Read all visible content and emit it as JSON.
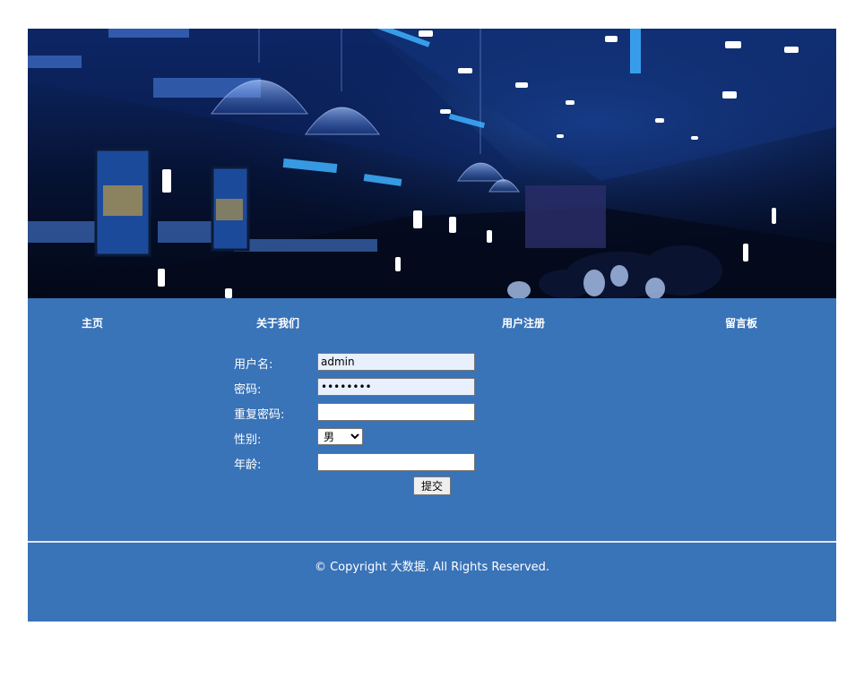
{
  "nav": {
    "items": [
      {
        "label": "主页"
      },
      {
        "label": "关于我们"
      },
      {
        "label": "用户注册"
      },
      {
        "label": "留言板"
      }
    ]
  },
  "form": {
    "username_label": "用户名:",
    "username_value": "admin",
    "password_label": "密码:",
    "password_value": "password",
    "repeat_password_label": "重复密码:",
    "repeat_password_value": "",
    "gender_label": "性别:",
    "gender_selected": "男",
    "age_label": "年龄:",
    "age_value": "",
    "submit_label": "提交"
  },
  "footer": {
    "copyright": "© Copyright 大数据. All Rights Reserved."
  },
  "banner": {
    "bg_color": "#071334",
    "light_color": "#2a7fff"
  },
  "colors": {
    "page_background": "#3973b8",
    "autofill_background": "#e8f0fe"
  }
}
